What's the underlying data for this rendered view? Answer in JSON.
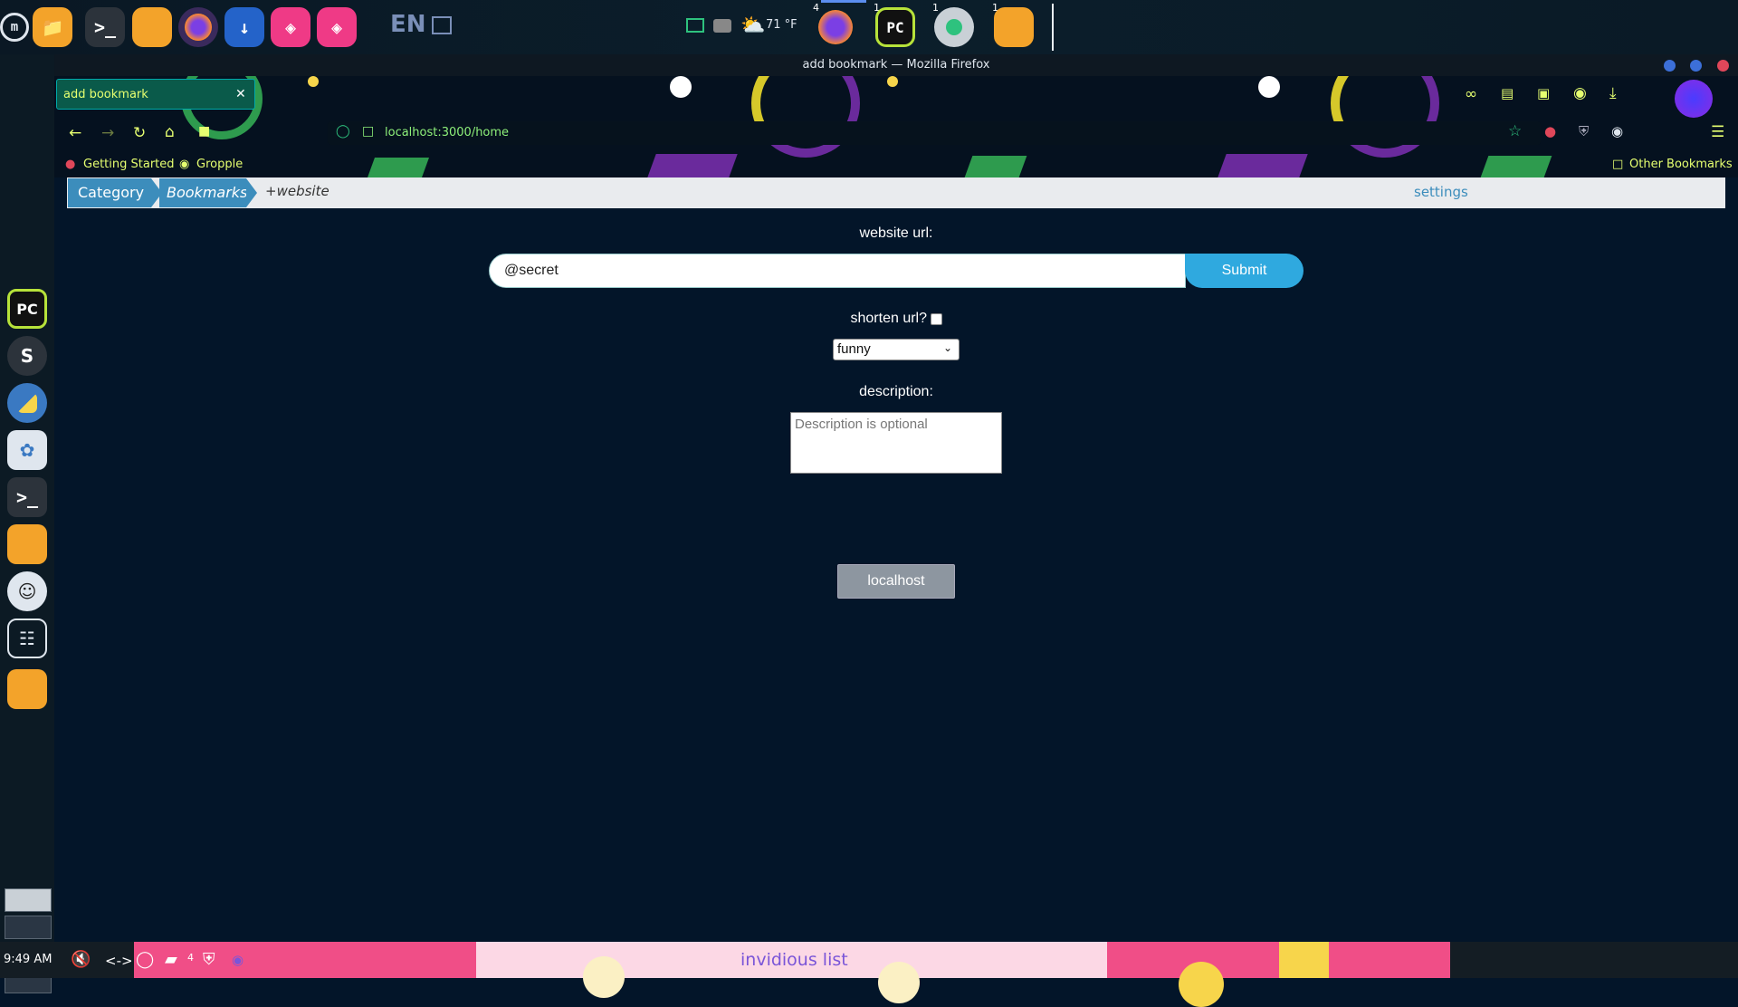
{
  "top_panel": {
    "language": "EN",
    "weather": "71 °F",
    "app_badges": [
      "4",
      "1",
      "1",
      "1"
    ]
  },
  "window": {
    "title": "add bookmark — Mozilla Firefox"
  },
  "browser": {
    "tab_title": "add bookmark",
    "url": "localhost:3000/home",
    "bookmarks": [
      "Getting Started",
      "Gropple"
    ],
    "other_bookmarks": "Other Bookmarks"
  },
  "page": {
    "breadcrumb": {
      "category": "Category",
      "bookmarks": "Bookmarks",
      "website": "+website",
      "settings": "settings"
    },
    "form": {
      "url_label": "website url:",
      "url_value": "@secret",
      "submit_label": "Submit",
      "shorten_label": "shorten url?",
      "category_selected": "funny",
      "description_label": "description:",
      "description_placeholder": "Description is optional",
      "localhost_button": "localhost"
    }
  },
  "bottom_panel": {
    "clock": "9:49 AM",
    "notification_count": "4",
    "media_title": "invidious list"
  }
}
